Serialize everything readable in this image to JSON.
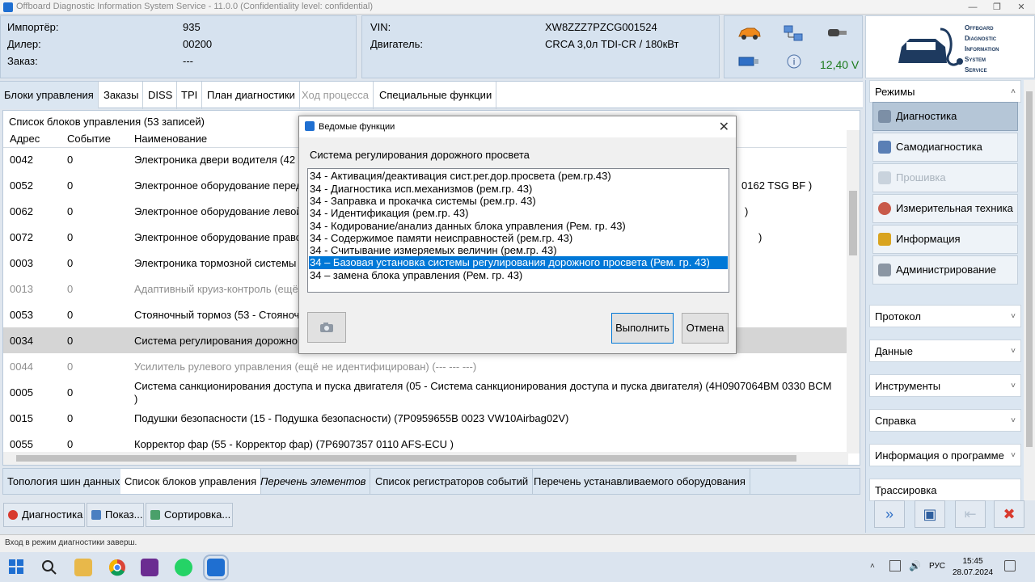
{
  "window": {
    "title": "Offboard Diagnostic Information System Service - 11.0.0 (Confidentiality level: confidential)"
  },
  "header": {
    "importer_label": "Импортёр:",
    "importer_value": "935",
    "dealer_label": "Дилер:",
    "dealer_value": "00200",
    "order_label": "Заказ:",
    "order_value": "---",
    "vin_label": "VIN:",
    "vin_value": "XW8ZZZ7PZCG001524",
    "engine_label": "Двигатель:",
    "engine_value": "CRCA 3,0л TDI-CR / 180кВт",
    "voltage": "12,40 V"
  },
  "logo": {
    "line1": "Offboard",
    "line2": "Diagnostic",
    "line3": "Information",
    "line4": "System",
    "line5": "Service"
  },
  "tabs": [
    {
      "label": "Блоки управления"
    },
    {
      "label": "Заказы"
    },
    {
      "label": "DISS"
    },
    {
      "label": "TPI"
    },
    {
      "label": "План диагностики"
    },
    {
      "label": "Ход процесса"
    },
    {
      "label": "Специальные функции"
    }
  ],
  "list": {
    "caption": "Список блоков управления (53 записей)",
    "headers": {
      "address": "Адрес",
      "event": "Событие",
      "name": "Наименование"
    },
    "rows": [
      {
        "address": "0042",
        "event": "0",
        "name": "Электроника двери водителя (42",
        "tail": ""
      },
      {
        "address": "0052",
        "event": "0",
        "name": "Электронное оборудование перед",
        "tail": "0162   TSG BF       )"
      },
      {
        "address": "0062",
        "event": "0",
        "name": "Электронное оборудование левой",
        "tail": ")"
      },
      {
        "address": "0072",
        "event": "0",
        "name": "Электронное оборудование право",
        "tail": ")"
      },
      {
        "address": "0003",
        "event": "0",
        "name": "Электроника тормозной системы",
        "tail": ""
      },
      {
        "address": "0013",
        "event": "0",
        "name": "Адаптивный круиз-контроль (ещё",
        "tail": ""
      },
      {
        "address": "0053",
        "event": "0",
        "name": "Стояночный тормоз (53 - Стояноч",
        "tail": ""
      },
      {
        "address": "0034",
        "event": "0",
        "name": "Система регулирования дорожно",
        "tail": ""
      },
      {
        "address": "0044",
        "event": "0",
        "name": "Усилитель рулевого управления (ещё не идентифицирован) (---   ---   ---)",
        "tail": ""
      },
      {
        "address": "0005",
        "event": "0",
        "name": "Система санкционирования доступа и пуска двигателя (05 - Система санкционирования доступа и пуска двигателя) (4H0907064BM   0330   BCM",
        "name2": ")",
        "tail": ""
      },
      {
        "address": "0015",
        "event": "0",
        "name": "Подушки безопасности (15 - Подушка безопасности) (7P0959655B    0023   VW10Airbag02V)",
        "tail": ""
      },
      {
        "address": "0055",
        "event": "0",
        "name": "Корректор фар (55 - Корректор фар) (7P6907357      0110   AFS-ECU      )",
        "tail": ""
      }
    ]
  },
  "bottom_tabs": [
    {
      "label": "Топология шин данных"
    },
    {
      "label": "Список блоков управления"
    },
    {
      "label": "Перечень элементов"
    },
    {
      "label": "Список регистраторов событий"
    },
    {
      "label": "Перечень устанавливаемого оборудования"
    }
  ],
  "actions": {
    "diagnostics": "Диагностика",
    "show": "Показ...",
    "sort": "Сортировка..."
  },
  "status": "Вход в режим диагностики заверш.",
  "sidebar": {
    "modes_header": "Режимы",
    "items": [
      {
        "label": "Диагностика"
      },
      {
        "label": "Самодиагностика"
      },
      {
        "label": "Прошивка"
      },
      {
        "label": "Измерительная техника"
      },
      {
        "label": "Информация"
      },
      {
        "label": "Администрирование"
      }
    ],
    "sections": [
      {
        "label": "Протокол"
      },
      {
        "label": "Данные"
      },
      {
        "label": "Инструменты"
      },
      {
        "label": "Справка"
      },
      {
        "label": "Информация о программе"
      },
      {
        "label": "Трассировка"
      }
    ]
  },
  "dialog": {
    "title": "Ведомые функции",
    "subtitle": "Система регулирования дорожного просвета",
    "items": [
      "34 - Активация/деактивация сист.рег.дор.просвета (рем.гр.43)",
      "34 - Диагностика исп.механизмов (рем.гр. 43)",
      "34 - Заправка и прокачка системы (рем.гр. 43)",
      "34 - Идентификация (рем.гр. 43)",
      "34 - Кодирование/анализ данных блока управления (Рем. гр. 43)",
      "34 - Содержимое памяти неисправностей (рем.гр. 43)",
      "34 - Считывание измеряемых величин (рем.гр. 43)",
      "34 – Базовая установка системы регулирования дорожного просвета (Рем. гр. 43)",
      "34 – замена блока управления (Рем. гр. 43)"
    ],
    "execute": "Выполнить",
    "cancel": "Отмена"
  },
  "taskbar": {
    "time": "15:45",
    "date": "28.07.2024",
    "lang": "РУС"
  },
  "colors": {
    "accent": "#0078d7",
    "panel": "#d6e2ef",
    "voltage": "#1a7a1a"
  }
}
